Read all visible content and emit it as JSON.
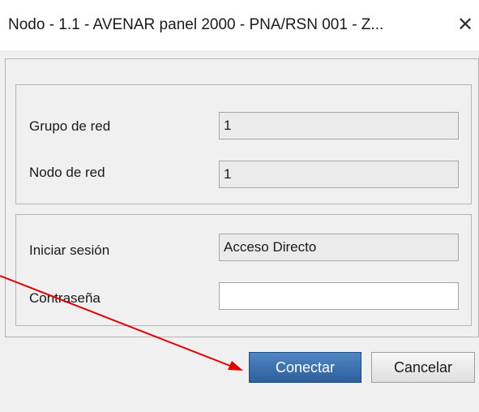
{
  "window": {
    "title": "Nodo - 1.1 - AVENAR panel 2000 - PNA/RSN 001 - Z...",
    "close_glyph": "✕"
  },
  "network": {
    "group_label": "Grupo de red",
    "group_value": "1",
    "node_label": "Nodo de red",
    "node_value": "1"
  },
  "login": {
    "user_label": "Iniciar sesión",
    "user_value": "Acceso Directo",
    "password_label": "Contraseña",
    "password_value": ""
  },
  "buttons": {
    "connect": "Conectar",
    "cancel": "Cancelar"
  },
  "colors": {
    "primary_button": "#2d5f9c",
    "annotation_arrow": "#e00000",
    "dialog_background": "#f0f0f0"
  },
  "icons": {
    "close": "close-icon"
  }
}
